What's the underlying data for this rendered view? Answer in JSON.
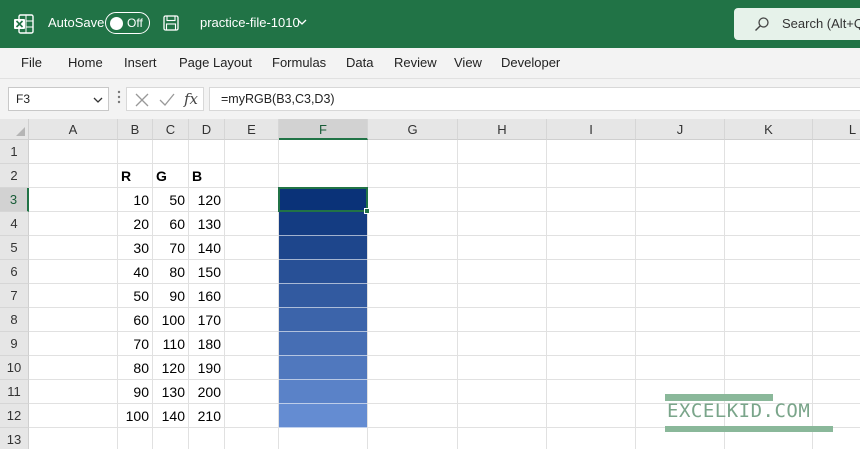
{
  "titlebar": {
    "autosave_label": "AutoSave",
    "autosave_state": "Off",
    "file_name": "practice-file-1010",
    "search_text": "Search (Alt+Q)",
    "brand_color": "#217346"
  },
  "menu": [
    "File",
    "Home",
    "Insert",
    "Page Layout",
    "Formulas",
    "Data",
    "Review",
    "View",
    "Developer"
  ],
  "namebox": {
    "value": "F3"
  },
  "formula": {
    "value": "=myRGB(B3,C3,D3)",
    "fx_label": "fx"
  },
  "columns": [
    "A",
    "B",
    "C",
    "D",
    "E",
    "F",
    "G",
    "H",
    "I",
    "J",
    "K",
    "L"
  ],
  "rows": [
    "1",
    "2",
    "3",
    "4",
    "5",
    "6",
    "7",
    "8",
    "9",
    "10",
    "11",
    "12",
    "13"
  ],
  "selected_cell": {
    "column": "F",
    "row": "3"
  },
  "headers": {
    "r": "R",
    "g": "G",
    "b": "B"
  },
  "data_rows": [
    {
      "r": "10",
      "g": "50",
      "b": "120",
      "fill": "#0a3278"
    },
    {
      "r": "20",
      "g": "60",
      "b": "130",
      "fill": "#143c82"
    },
    {
      "r": "30",
      "g": "70",
      "b": "140",
      "fill": "#1e468c"
    },
    {
      "r": "40",
      "g": "80",
      "b": "150",
      "fill": "#285096"
    },
    {
      "r": "50",
      "g": "90",
      "b": "160",
      "fill": "#325aa0"
    },
    {
      "r": "60",
      "g": "100",
      "b": "170",
      "fill": "#3c64aa"
    },
    {
      "r": "70",
      "g": "110",
      "b": "180",
      "fill": "#466eb4"
    },
    {
      "r": "80",
      "g": "120",
      "b": "190",
      "fill": "#5078be"
    },
    {
      "r": "90",
      "g": "130",
      "b": "200",
      "fill": "#5a82c8"
    },
    {
      "r": "100",
      "g": "140",
      "b": "210",
      "fill": "#648cd2"
    }
  ],
  "watermark": {
    "text": "EXCELKID.COM"
  }
}
